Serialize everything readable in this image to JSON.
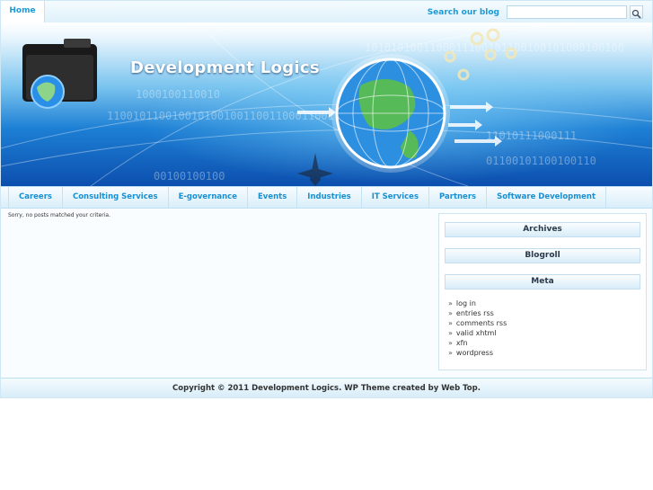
{
  "topbar": {
    "home_label": "Home",
    "search_label": "Search our blog",
    "search_value": "",
    "search_icon": "magnifier-icon"
  },
  "banner": {
    "site_title": "Development Logics",
    "binary_rows": [
      "1010101001100011100101100100101000100100",
      "11001011001001010010011001100011001",
      "1000100110010",
      "11010111000111",
      "01100101100100110",
      "00100100100"
    ]
  },
  "nav": {
    "items": [
      "Careers",
      "Consulting Services",
      "E-governance",
      "Events",
      "Industries",
      "IT Services",
      "Partners",
      "Software Development"
    ]
  },
  "content": {
    "message": "Sorry, no posts matched your criteria."
  },
  "sidebar": {
    "archives_title": "Archives",
    "blogroll_title": "Blogroll",
    "meta_title": "Meta",
    "meta_links": [
      "log in",
      "entries rss",
      "comments rss",
      "valid xhtml",
      "xfn",
      "wordpress"
    ]
  },
  "footer": {
    "text": "Copyright © 2011 Development Logics. WP Theme created by Web Top."
  },
  "colors": {
    "accent": "#1e9ad6",
    "banner_dark": "#0c4fae"
  }
}
